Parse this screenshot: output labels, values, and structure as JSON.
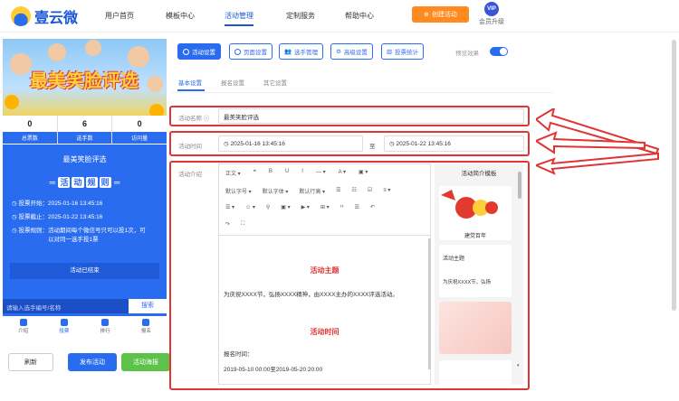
{
  "brand": {
    "name": "壹云微"
  },
  "nav": {
    "items": [
      "用户首页",
      "模板中心",
      "活动管理",
      "定制服务",
      "帮助中心"
    ],
    "create_label": "创建活动",
    "vip_badge": "VIP",
    "vip_label": "会员升级"
  },
  "preview": {
    "banner_title": "最美笑脸评选",
    "stats": [
      {
        "value": "0",
        "label": "总票数"
      },
      {
        "value": "6",
        "label": "选手数"
      },
      {
        "value": "0",
        "label": "访问量"
      }
    ],
    "activity_name": "最美笑脸评选",
    "rules_title": [
      "活",
      "动",
      "规",
      "则"
    ],
    "rule_start": "投票开始：2025-01-16 13:45:16",
    "rule_end": "投票截止：2025-01-22 13:45:16",
    "rule_desc_1": "投票规则：活动期间每个微信号只可以投1次，可",
    "rule_desc_2": "以对同一选手投1票",
    "result_label": "活动已结束",
    "search_placeholder": "请输入选手编号/名称",
    "search_button": "搜索",
    "tabs": [
      "介绍",
      "投票",
      "排行",
      "报名"
    ]
  },
  "bottom_buttons": {
    "refresh": "刷新",
    "publish": "发布活动",
    "poster": "活动海报"
  },
  "toolbar": {
    "buttons": [
      "活动设置",
      "页面设置",
      "选手管理",
      "高级设置",
      "投票统计"
    ],
    "preview_label": "预览效果",
    "preview_on": true
  },
  "subtabs": [
    "基本设置",
    "报名设置",
    "其它设置"
  ],
  "form": {
    "name_label": "活动名称 ⓘ",
    "name_value": "最美笑脸评选",
    "time_label": "活动时间",
    "time_start": "2025-01-16 13:45:16",
    "time_sep": "至",
    "time_end": "2025-01-22 13:45:16",
    "intro_label": "活动介绍"
  },
  "editor": {
    "row1": [
      "正文 ▾",
      "❝",
      "B",
      "U",
      "I",
      "— ▾",
      "A ▾",
      "▣ ▾"
    ],
    "row2": [
      "默认字号 ▾",
      "默认字体 ▾",
      "默认行高 ▾",
      "☰",
      "☷",
      "☑",
      "≡ ▾"
    ],
    "row3": [
      "☰ ▾",
      "☺ ▾",
      "⚲",
      "▣ ▾",
      "▶ ▾",
      "⊞ ▾",
      "‹›",
      "☰",
      "↶"
    ],
    "row4": [
      "↷",
      "⛶"
    ],
    "heading1": "活动主题",
    "text1": "为庆祝XXXX节，弘扬XXXX精神，由XXXX主办的XXXX评选活动。",
    "heading2": "活动时间",
    "text2": "报名时间：",
    "text3": "2019-05-10 00:00至2019-05-20 20:00"
  },
  "templates": {
    "title": "活动简介模板",
    "card1_caption": "建党百年",
    "card2_title": "活动主题",
    "card2_text": "为庆祝XXXX节，弘扬"
  },
  "colors": {
    "primary": "#2a6cf0",
    "accent": "#ff8a1f",
    "highlight": "#e03535",
    "success": "#5dc24a"
  }
}
